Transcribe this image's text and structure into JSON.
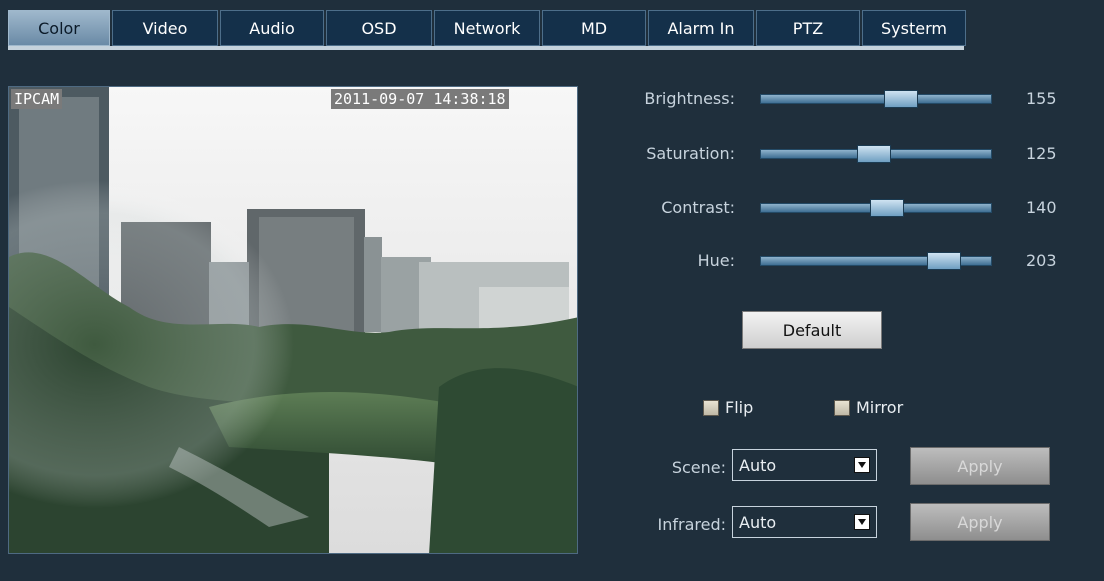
{
  "tabs": [
    {
      "label": "Color",
      "active": true
    },
    {
      "label": "Video",
      "active": false
    },
    {
      "label": "Audio",
      "active": false
    },
    {
      "label": "OSD",
      "active": false
    },
    {
      "label": "Network",
      "active": false
    },
    {
      "label": "MD",
      "active": false
    },
    {
      "label": "Alarm In",
      "active": false
    },
    {
      "label": "PTZ",
      "active": false
    },
    {
      "label": "Systerm",
      "active": false
    }
  ],
  "preview": {
    "camera_name": "IPCAM",
    "timestamp": "2011-09-07 14:38:18"
  },
  "sliders": {
    "brightness": {
      "label": "Brightness:",
      "value": "155",
      "max": 255
    },
    "saturation": {
      "label": "Saturation:",
      "value": "125",
      "max": 255
    },
    "contrast": {
      "label": "Contrast:",
      "value": "140",
      "max": 255
    },
    "hue": {
      "label": "Hue:",
      "value": "203",
      "max": 255
    }
  },
  "buttons": {
    "default_label": "Default",
    "apply_label": "Apply"
  },
  "checkboxes": {
    "flip": {
      "label": "Flip",
      "checked": false
    },
    "mirror": {
      "label": "Mirror",
      "checked": false
    }
  },
  "fields": {
    "scene": {
      "label": "Scene:",
      "value": "Auto"
    },
    "infrared": {
      "label": "Infrared:",
      "value": "Auto"
    }
  },
  "colors": {
    "background": "#1f2f3c",
    "tab_bg": "#14304a",
    "tab_active_bg": "#9fb8cc",
    "slider_track": "#5f8fb3",
    "label_text": "#c7d3dd"
  },
  "icons": {
    "dropdown": "chevron-down-icon"
  }
}
